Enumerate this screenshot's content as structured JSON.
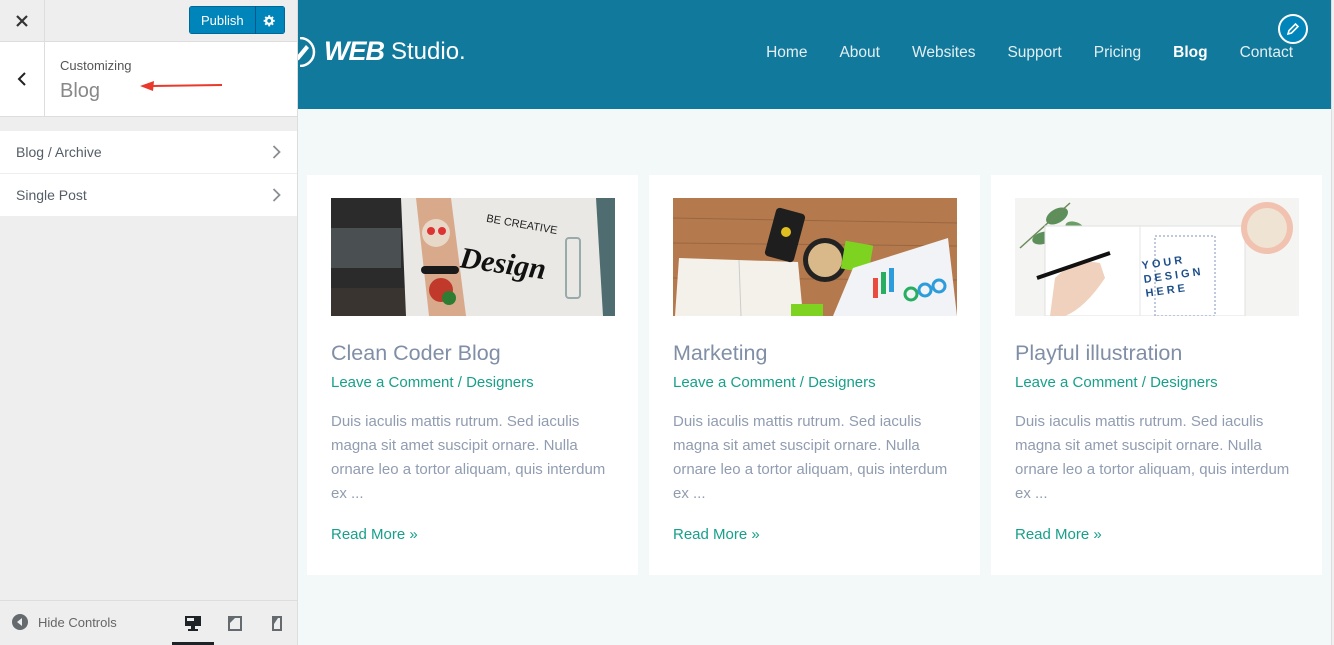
{
  "customizer": {
    "close_icon": "close-icon",
    "publish_label": "Publish",
    "settings_icon": "gear-icon",
    "back_icon": "chevron-left-icon",
    "customizing_label": "Customizing",
    "panel_title": "Blog",
    "annotation": "red-arrow pointing to panel title",
    "sections": [
      {
        "label": "Blog / Archive",
        "icon": "chevron-right-icon"
      },
      {
        "label": "Single Post",
        "icon": "chevron-right-icon"
      }
    ],
    "footer": {
      "hide_controls_label": "Hide Controls",
      "devices": [
        {
          "name": "desktop",
          "icon": "desktop-icon",
          "active": true
        },
        {
          "name": "tablet",
          "icon": "tablet-icon",
          "active": false
        },
        {
          "name": "mobile",
          "icon": "mobile-icon",
          "active": false
        }
      ]
    }
  },
  "site": {
    "logo": {
      "bold": "WEB",
      "light": "Studio."
    },
    "nav": [
      "Home",
      "About",
      "Websites",
      "Support",
      "Pricing",
      "Blog",
      "Contact"
    ],
    "active_nav": "Blog",
    "colors": {
      "header": "#117a9c",
      "accent": "#17a08a",
      "publish": "#0085ba"
    },
    "posts": [
      {
        "title": "Clean Coder Blog",
        "meta_comment": "Leave a Comment",
        "meta_sep": " / ",
        "meta_category": "Designers",
        "excerpt": "Duis iaculis mattis rutrum. Sed iaculis magna sit amet suscipit ornare. Nulla ornare leo a tortor aliquam, quis interdum ex ...",
        "read_more": "Read More »",
        "image_text_1": "BE CREATIVE",
        "image_text_2": "Design"
      },
      {
        "title": "Marketing",
        "meta_comment": "Leave a Comment",
        "meta_sep": " / ",
        "meta_category": "Designers",
        "excerpt": "Duis iaculis mattis rutrum. Sed iaculis magna sit amet suscipit ornare. Nulla ornare leo a tortor aliquam, quis interdum ex ...",
        "read_more": "Read More »"
      },
      {
        "title": "Playful illustration",
        "meta_comment": "Leave a Comment",
        "meta_sep": " / ",
        "meta_category": "Designers",
        "excerpt": "Duis iaculis mattis rutrum. Sed iaculis magna sit amet suscipit ornare. Nulla ornare leo a tortor aliquam, quis interdum ex ...",
        "read_more": "Read More »",
        "image_text_1": "YOUR",
        "image_text_2": "DESIGN",
        "image_text_3": "HERE"
      }
    ]
  }
}
